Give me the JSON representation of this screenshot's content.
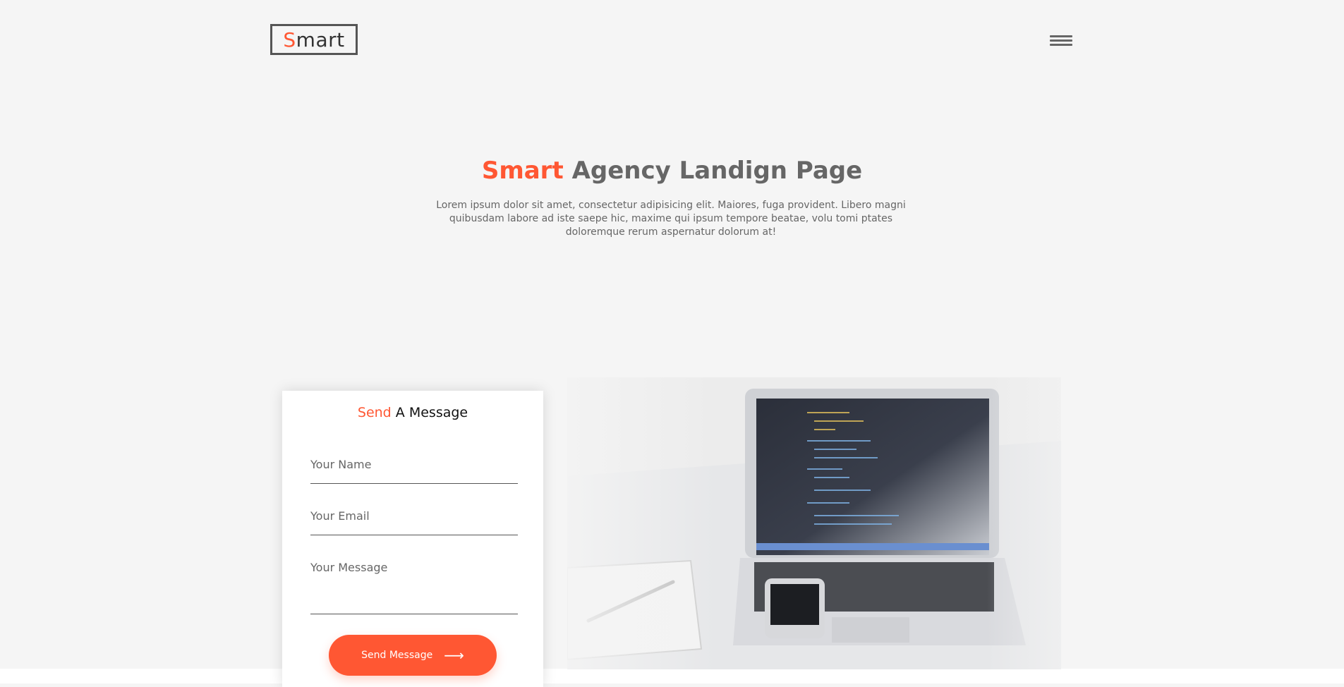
{
  "header": {
    "logo": {
      "first": "S",
      "rest": "mart"
    }
  },
  "hero": {
    "title_accent": "Smart",
    "title_rest": "Agency Landign Page",
    "description": "Lorem ipsum dolor sit amet, consectetur adipisicing elit. Maiores, fuga provident. Libero magni quibusdam labore ad iste saepe hic, maxime qui ipsum tempore beatae, volu tomi ptates doloremque rerum aspernatur dolorum at!"
  },
  "contact_form": {
    "title_accent": "Send",
    "title_rest": "A Message",
    "name_placeholder": "Your Name",
    "email_placeholder": "Your Email",
    "message_placeholder": "Your Message",
    "submit_label": "Send Message",
    "submit_icon": "arrow-right-icon"
  },
  "colors": {
    "accent": "#ff5733",
    "background": "#f5f5f5",
    "text": "#666666"
  }
}
